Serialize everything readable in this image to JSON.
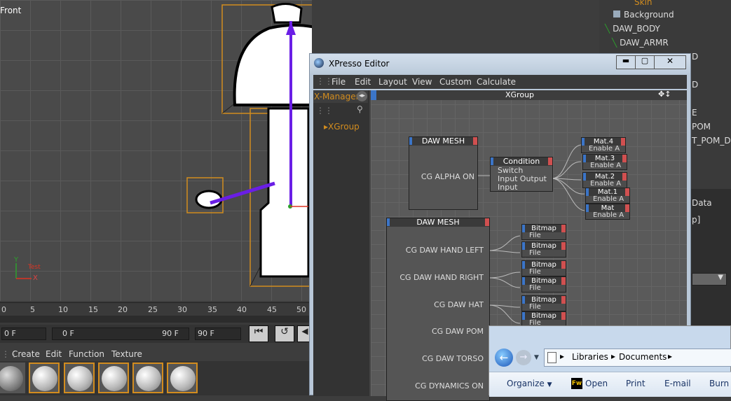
{
  "viewport": {
    "label": "Front",
    "character_text": "Test",
    "axis_x": "X",
    "axis_y": "Y"
  },
  "object_manager": {
    "items": [
      "Skin",
      "Background",
      "DAW_BODY",
      "DAW_ARMR"
    ],
    "clipped_items": [
      "D",
      "D",
      "E",
      "POM",
      "T_POM_D"
    ]
  },
  "attributes": {
    "tab": "Data",
    "clipped_value": "p]"
  },
  "timeline": {
    "ticks": [
      "0",
      "5",
      "10",
      "15",
      "20",
      "25",
      "30",
      "35",
      "40",
      "45",
      "50"
    ],
    "current_frame": "0 F",
    "range_start": "0 F",
    "range_end": "90 F",
    "max_frame": "90 F"
  },
  "material_manager": {
    "menu": [
      "Create",
      "Edit",
      "Function",
      "Texture"
    ]
  },
  "xpresso": {
    "title": "XPresso Editor",
    "menu": [
      "File",
      "Edit",
      "Layout",
      "View",
      "Custom",
      "Calculate"
    ],
    "xmanager_label": "X-Manager",
    "tree_item": "XGroup",
    "canvas_title": "XGroup",
    "node_daw_mesh_1": {
      "title": "DAW MESH",
      "port": "CG ALPHA ON"
    },
    "node_condition": {
      "title": "Condition",
      "ports": [
        "Switch",
        "Input",
        "Input"
      ],
      "output": "Output"
    },
    "mat_nodes": [
      {
        "title": "Mat.4",
        "port": "Enable A"
      },
      {
        "title": "Mat.3",
        "port": "Enable A"
      },
      {
        "title": "Mat.2",
        "port": "Enable A"
      },
      {
        "title": "Mat.1",
        "port": "Enable A"
      },
      {
        "title": "Mat",
        "port": "Enable A"
      }
    ],
    "node_daw_mesh_2": {
      "title": "DAW MESH",
      "ports": [
        "CG DAW HAND LEFT",
        "CG DAW HAND RIGHT",
        "CG DAW HAT",
        "CG DAW POM",
        "CG DAW TORSO",
        "CG DYNAMICS ON"
      ]
    },
    "bitmap_nodes": [
      {
        "title": "Bitmap",
        "port": "File"
      },
      {
        "title": "Bitmap",
        "port": "File"
      },
      {
        "title": "Bitmap",
        "port": "File"
      },
      {
        "title": "Bitmap",
        "port": "File"
      },
      {
        "title": "Bitmap",
        "port": "File"
      },
      {
        "title": "Bitmap",
        "port": "File"
      }
    ]
  },
  "explorer": {
    "breadcrumb": [
      "Libraries",
      "Documents"
    ],
    "toolbar": [
      "Organize",
      "Open",
      "Print",
      "E-mail",
      "Burn"
    ]
  },
  "colors": {
    "accent_orange": "#d28c1e",
    "axis_purple": "#6a1ee6",
    "port_blue": "#3b75c8",
    "port_red": "#d05050"
  }
}
